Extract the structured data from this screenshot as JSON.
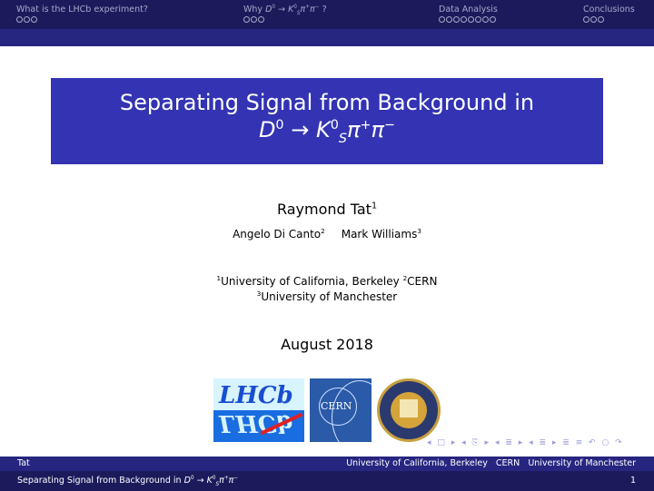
{
  "header": {
    "sections": [
      {
        "label": "What is the LHCb experiment?",
        "dots": 3
      },
      {
        "label_prefix": "Why ",
        "label_math": "D⁰ → K⁰S π⁺π⁻?",
        "dots": 3
      },
      {
        "label": "Data Analysis",
        "dots": 8
      },
      {
        "label": "Conclusions",
        "dots": 3
      }
    ],
    "why_word": "Why",
    "why_D": "D",
    "why_D_sup": "0",
    "why_arrow": "→",
    "why_K": "K",
    "why_K_sup": "0",
    "why_K_sub": "S",
    "why_pi1": "π",
    "why_pi1_sup": "+",
    "why_pi2": "π",
    "why_pi2_sup": "−",
    "why_q": "?"
  },
  "title": {
    "line1": "Separating Signal from Background in",
    "D": "D",
    "D_sup": "0",
    "arrow": "→",
    "K": "K",
    "K_sup": "0",
    "K_sub": "S",
    "pi": "π",
    "plus": "+",
    "minus": "−"
  },
  "author": {
    "name": "Raymond Tat",
    "mark": "1"
  },
  "coauthors": [
    {
      "name": "Angelo Di Canto",
      "mark": "2"
    },
    {
      "name": "Mark Williams",
      "mark": "3"
    }
  ],
  "institutions": [
    {
      "mark": "1",
      "name": "University of California, Berkeley"
    },
    {
      "mark": "2",
      "name": "CERN"
    },
    {
      "mark": "3",
      "name": "University of Manchester"
    }
  ],
  "date": "August 2018",
  "logos": {
    "lhcb": "LHCb",
    "lhcb_mirror": "LHCb",
    "cern": "CERN",
    "uc": "University of California seal"
  },
  "nav_symbols": "◂ □ ▸ ◂ ⎘ ▸ ◂ ≣ ▸ ◂ ≣ ▸ ≣ ≡ ↶ ○ ↷",
  "footer": {
    "author": "Tat",
    "institutes": "University of California, Berkeley   CERN   University of Manchester",
    "short_title": "Separating Signal from Background in",
    "page": "1"
  }
}
